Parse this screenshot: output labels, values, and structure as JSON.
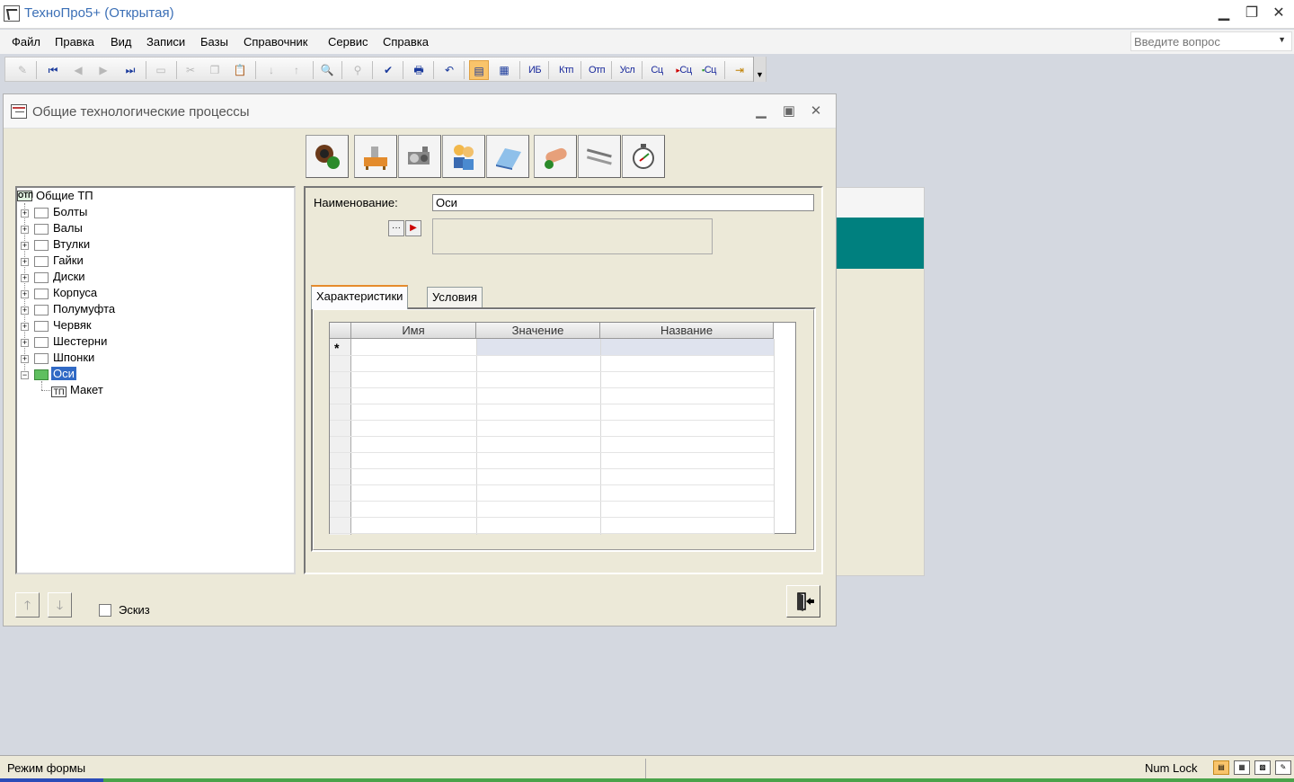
{
  "app": {
    "title": "ТехноПро5+ (Открытая)"
  },
  "window_buttons": {
    "minimize": "▁",
    "restore": "❐",
    "close": "✕"
  },
  "menu": {
    "items": [
      "Файл",
      "Правка",
      "Вид",
      "Записи",
      "Базы",
      "Справочник",
      "Сервис",
      "Справка"
    ],
    "ask_placeholder": "Введите вопрос"
  },
  "toolbar": {
    "text_buttons": [
      "ИБ",
      "Ктп",
      "Отп",
      "Усл",
      "Сц",
      "Сц",
      "Сц"
    ]
  },
  "form": {
    "title": "Общие технологические процессы",
    "tree": {
      "root": {
        "icon_text": "ОТП",
        "label": "Общие ТП"
      },
      "items": [
        "Болты",
        "Валы",
        "Втулки",
        "Гайки",
        "Диски",
        "Корпуса",
        "Полумуфта",
        "Червяк",
        "Шестерни",
        "Шпонки",
        "Оси"
      ],
      "selected": "Оси",
      "child": {
        "icon_text": "ТП",
        "label": "Макет"
      }
    },
    "name_label": "Наименование:",
    "name_value": "Оси",
    "tabs": [
      "Характеристики",
      "Условия"
    ],
    "active_tab": "Характеристики",
    "grid": {
      "columns": [
        "Имя",
        "Значение",
        "Название"
      ],
      "new_row_marker": "*"
    },
    "sketch_label": "Эскиз",
    "sketch_checked": false
  },
  "statusbar": {
    "mode": "Режим формы",
    "numlock": "Num Lock"
  }
}
